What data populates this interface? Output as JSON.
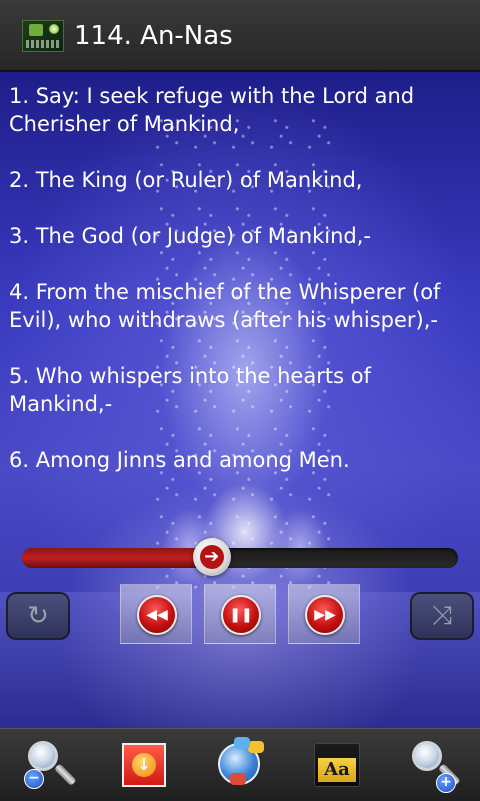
{
  "header": {
    "title": "114. An-Nas",
    "icon": "quran-app-icon"
  },
  "verses": [
    "1. Say: I seek refuge with the Lord and Cherisher of Mankind,",
    "2. The King (or Ruler) of Mankind,",
    "3. The God (or Judge) of Mankind,-",
    "4. From the mischief of the Whisperer (of Evil), who withdraws (after his whisper),-",
    "5. Who whispers into the hearts of Mankind,-",
    "6. Among Jinns and among Men."
  ],
  "player": {
    "progress": 0.435,
    "thumb_icon": "arrow-right-icon",
    "controls": {
      "repeat_icon": "repeat-icon",
      "rewind_icon": "rewind-icon",
      "pause_icon": "pause-icon",
      "forward_icon": "fast-forward-icon",
      "shuffle_icon": "shuffle-icon",
      "rewind_glyph": "◀◀",
      "pause_glyph": "❚❚",
      "forward_glyph": "▶▶",
      "repeat_glyph": "↻",
      "shuffle_glyph": "⤨"
    }
  },
  "toolbar": {
    "zoom_out_icon": "zoom-out-icon",
    "download_icon": "download-icon",
    "translate_icon": "globe-chat-icon",
    "font_icon": "font-size-icon",
    "zoom_in_icon": "zoom-in-icon",
    "font_label": "Aa",
    "zoom_out_glyph": "−",
    "zoom_in_glyph": "+",
    "download_glyph": "↓"
  },
  "colors": {
    "seek_fill": "#c02020",
    "button_red": "#c40f0f",
    "background_blue": "#3a3ac0"
  }
}
